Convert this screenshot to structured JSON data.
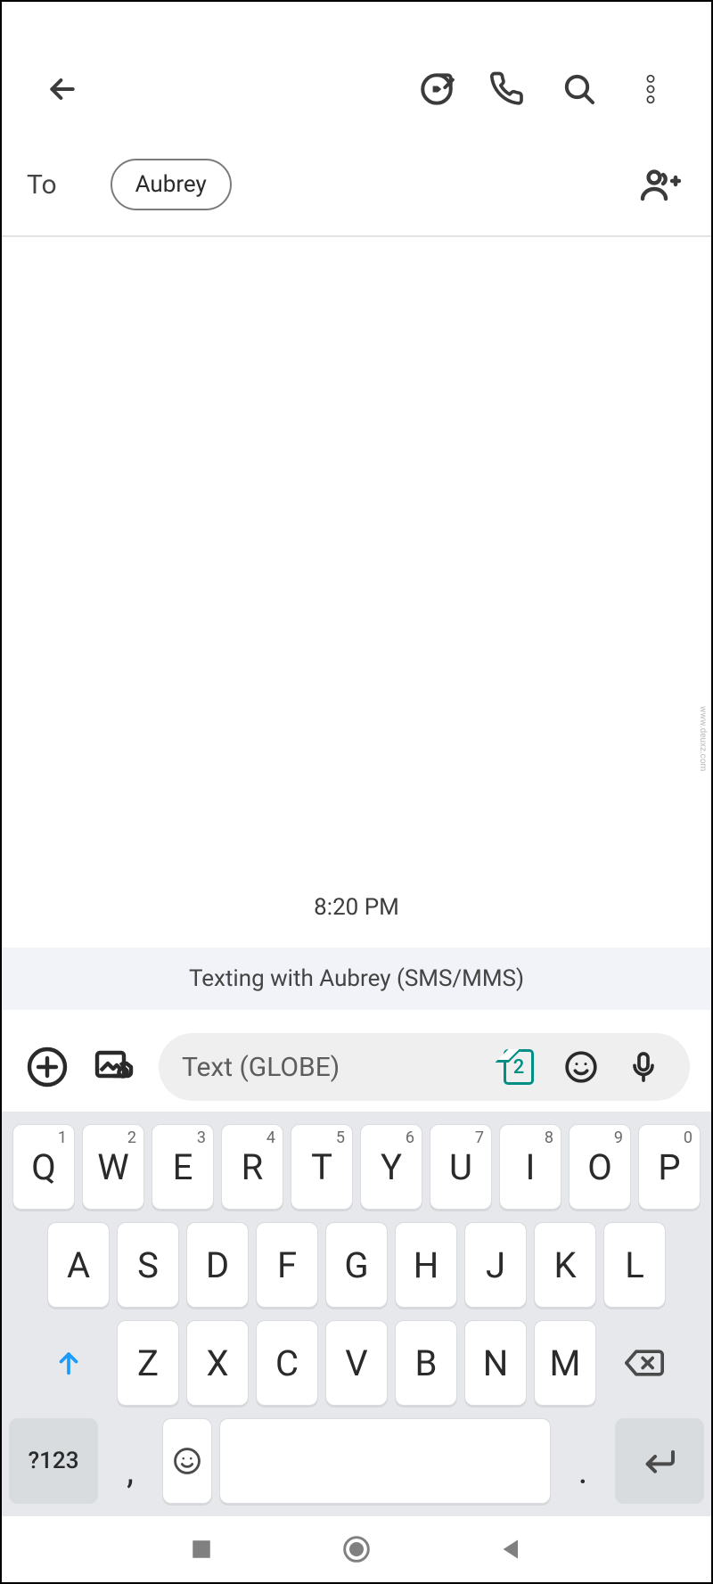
{
  "appbar": {
    "icons": {
      "back": "back-icon",
      "video": "video-call-icon",
      "phone": "phone-icon",
      "search": "search-icon",
      "more": "more-vert-icon"
    }
  },
  "recipient": {
    "label": "To",
    "chip": "Aubrey",
    "add_icon": "add-person-icon"
  },
  "conversation": {
    "timestamp": "8:20 PM",
    "banner": "Texting with Aubrey (SMS/MMS)"
  },
  "compose": {
    "attach_icon": "add-attachment-icon",
    "gallery_icon": "gallery-camera-icon",
    "placeholder": "Text (GLOBE)",
    "sim_number": "2",
    "emoji_icon": "emoji-icon",
    "mic_icon": "mic-icon"
  },
  "keyboard": {
    "row1": [
      {
        "l": "Q",
        "s": "1"
      },
      {
        "l": "W",
        "s": "2"
      },
      {
        "l": "E",
        "s": "3"
      },
      {
        "l": "R",
        "s": "4"
      },
      {
        "l": "T",
        "s": "5"
      },
      {
        "l": "Y",
        "s": "6"
      },
      {
        "l": "U",
        "s": "7"
      },
      {
        "l": "I",
        "s": "8"
      },
      {
        "l": "O",
        "s": "9"
      },
      {
        "l": "P",
        "s": "0"
      }
    ],
    "row2": [
      "A",
      "S",
      "D",
      "F",
      "G",
      "H",
      "J",
      "K",
      "L"
    ],
    "row3": [
      "Z",
      "X",
      "C",
      "V",
      "B",
      "N",
      "M"
    ],
    "row4": {
      "symbols": "?123",
      "comma": ",",
      "dot": "."
    }
  },
  "navbar": {
    "recent": "recent-apps-icon",
    "home": "home-icon",
    "back": "back-nav-icon"
  },
  "watermark": "www.deuxz.com"
}
